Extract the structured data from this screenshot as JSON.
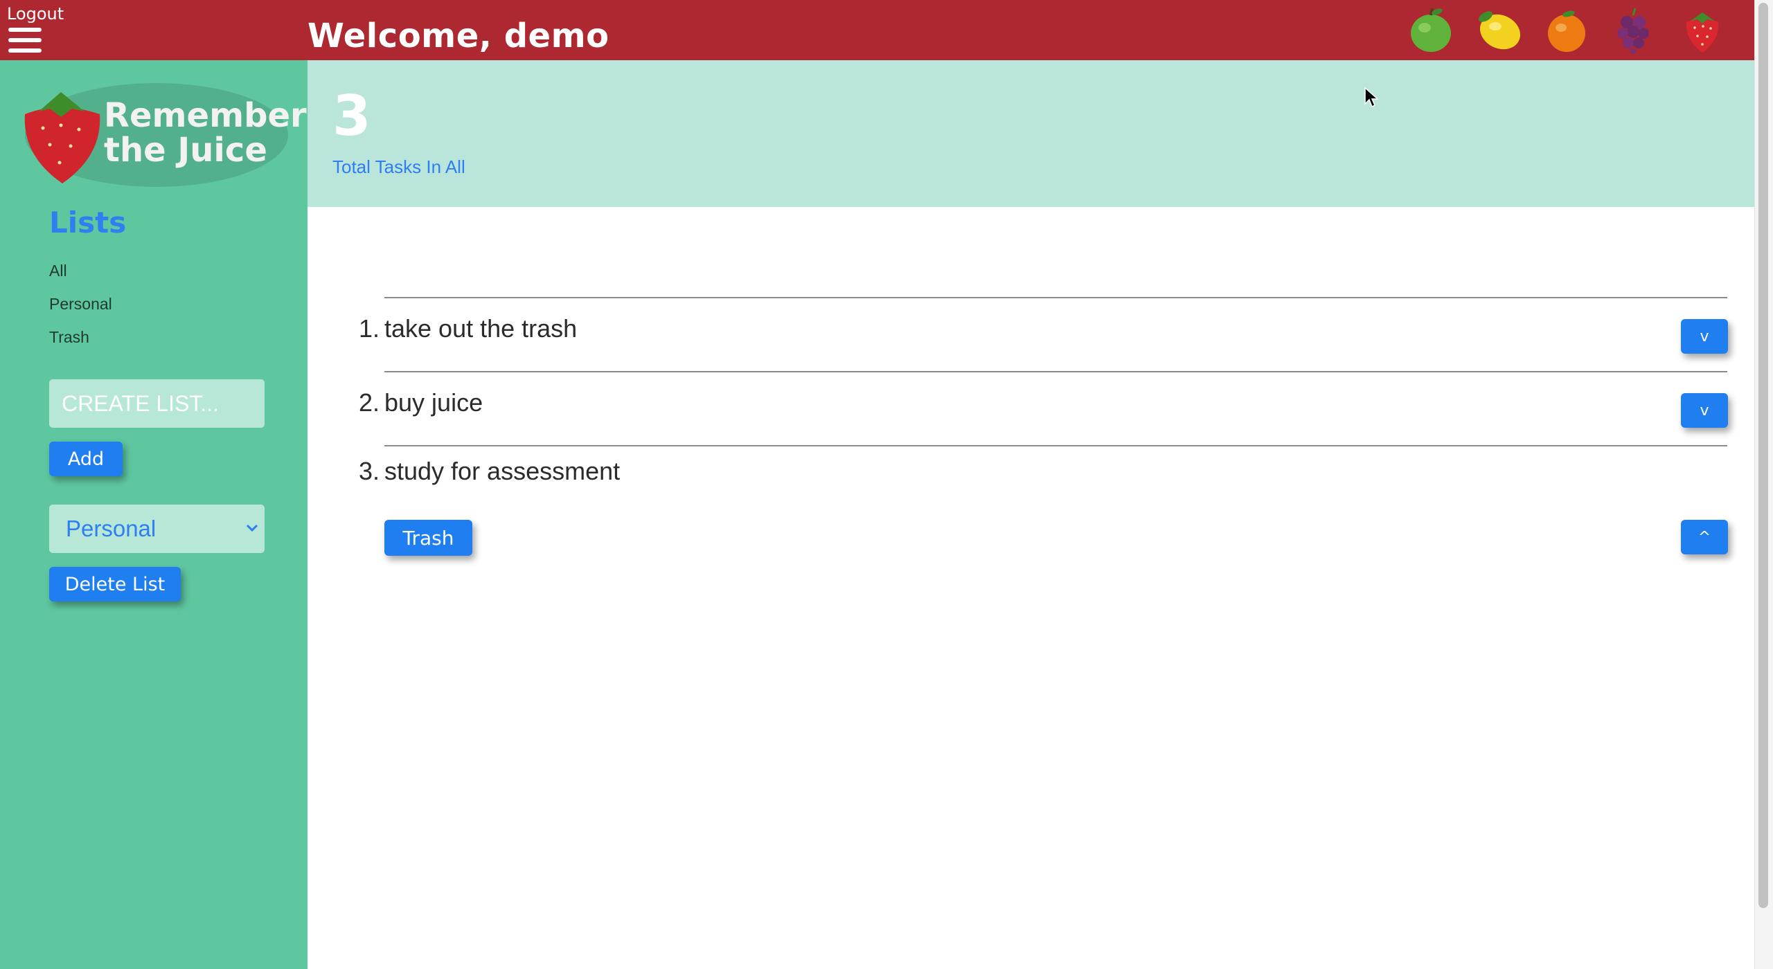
{
  "header": {
    "logout_label": "Logout",
    "welcome_text": "Welcome, demo",
    "fruit_icons": [
      "apple-icon",
      "lemon-icon",
      "orange-icon",
      "grape-icon",
      "strawberry-icon"
    ]
  },
  "sidebar": {
    "logo_text_line1": "Remember",
    "logo_text_line2": "the Juice",
    "lists_heading": "Lists",
    "list_items": [
      {
        "label": "All"
      },
      {
        "label": "Personal"
      },
      {
        "label": "Trash"
      }
    ],
    "create_list_placeholder": "CREATE LIST...",
    "add_button_label": "Add",
    "selected_list": "Personal",
    "delete_button_label": "Delete List"
  },
  "stats": {
    "total_count": "3",
    "total_label": "Total Tasks In All"
  },
  "tasks": [
    {
      "number": "1.",
      "text": "take out the trash",
      "toggle_label": "v"
    },
    {
      "number": "2.",
      "text": "buy juice",
      "toggle_label": "v"
    },
    {
      "number": "3.",
      "text": "study for assessment",
      "toggle_label": "^"
    }
  ],
  "expanded_task": {
    "trash_button_label": "Trash"
  },
  "colors": {
    "header_bg": "#ad2830",
    "sidebar_bg": "#5fc7a0",
    "stats_bg": "#b9e5da",
    "accent_blue": "#1f7ef0"
  }
}
